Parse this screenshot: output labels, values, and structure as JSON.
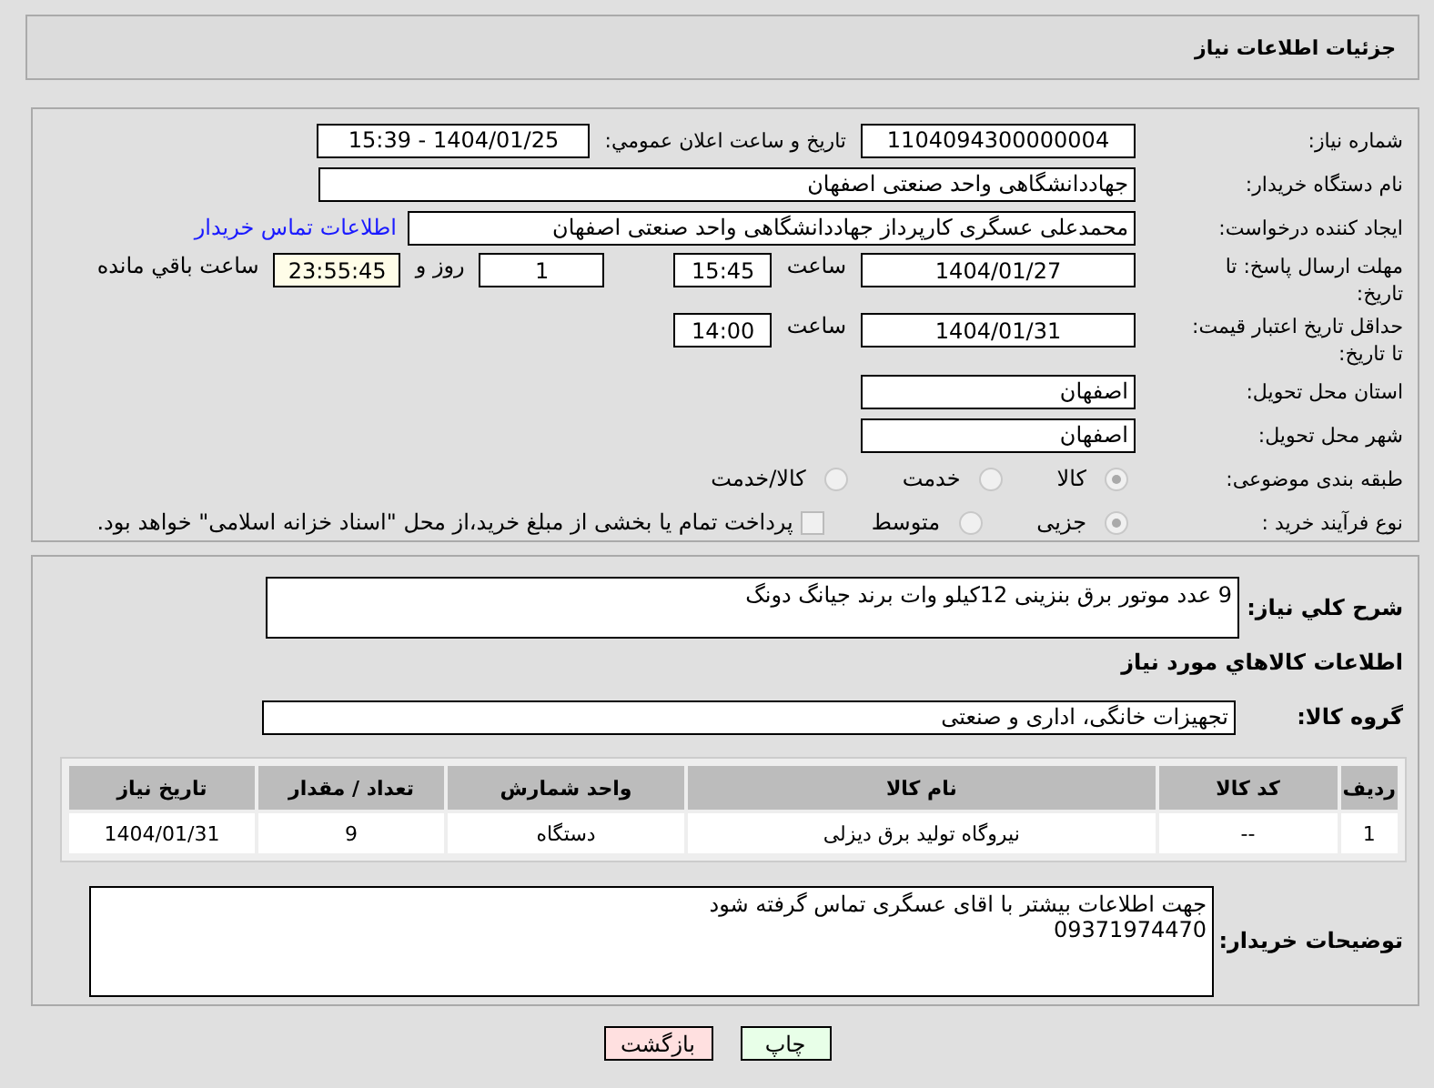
{
  "header": {
    "title": "جزئیات اطلاعات نیاز"
  },
  "fields": {
    "need_number": {
      "label": "شماره نیاز:",
      "value": "1104094300000004"
    },
    "announce": {
      "label": "تاریخ و ساعت اعلان عمومي:",
      "value": "1404/01/25 - 15:39"
    },
    "buyer": {
      "label": "نام دستگاه خریدار:",
      "value": "جهاددانشگاهی واحد صنعتی اصفهان"
    },
    "creator": {
      "label": "ایجاد کننده درخواست:",
      "value": "محمدعلی عسگری کارپرداز جهاددانشگاهی واحد صنعتی اصفهان",
      "link": "اطلاعات تماس خریدار"
    },
    "deadline": {
      "label": "مهلت ارسال پاسخ: تا تاریخ:",
      "date": "1404/01/27",
      "time_label": "ساعت",
      "time": "15:45",
      "days": "1",
      "days_label": "روز و",
      "remaining": "23:55:45",
      "remaining_label": "ساعت باقي مانده"
    },
    "validity": {
      "label": "حداقل تاریخ اعتبار قیمت: تا تاریخ:",
      "date": "1404/01/31",
      "time_label": "ساعت",
      "time": "14:00"
    },
    "province": {
      "label": "استان محل تحویل:",
      "value": "اصفهان"
    },
    "city": {
      "label": "شهر محل تحویل:",
      "value": "اصفهان"
    },
    "category": {
      "label": "طبقه بندی موضوعی:",
      "options": [
        {
          "label": "کالا",
          "selected": true
        },
        {
          "label": "خدمت",
          "selected": false
        },
        {
          "label": "کالا/خدمت",
          "selected": false
        }
      ]
    },
    "process": {
      "label": "نوع فرآیند خرید :",
      "options": [
        {
          "label": "جزیی",
          "selected": true
        },
        {
          "label": "متوسط",
          "selected": false
        }
      ],
      "payment": {
        "label": "پرداخت تمام یا بخشی از مبلغ خرید،از محل \"اسناد خزانه اسلامی\" خواهد بود.",
        "checked": false
      }
    }
  },
  "description": {
    "label": "شرح کلي نیاز:",
    "value": "9 عدد موتور برق بنزینی 12کیلو وات برند جیانگ دونگ"
  },
  "goods_heading": "اطلاعات کالاهاي مورد نیاز",
  "group": {
    "label": "گروه کالا:",
    "value": "تجهیزات خانگی، اداری و صنعتی"
  },
  "table": {
    "columns": [
      "ردیف",
      "کد کالا",
      "نام کالا",
      "واحد شمارش",
      "تعداد / مقدار",
      "تاریخ نیاز"
    ],
    "rows": [
      [
        "1",
        "--",
        "نیروگاه تولید برق دیزلی",
        "دستگاه",
        "9",
        "1404/01/31"
      ]
    ]
  },
  "notes": {
    "label": "توضیحات خریدار:",
    "lines": [
      "جهت اطلاعات بیشتر با اقای عسگری تماس گرفته شود",
      "09371974470"
    ]
  },
  "buttons": [
    {
      "label": "چاپ",
      "kind": "print"
    },
    {
      "label": "بازگشت",
      "kind": "back"
    }
  ]
}
